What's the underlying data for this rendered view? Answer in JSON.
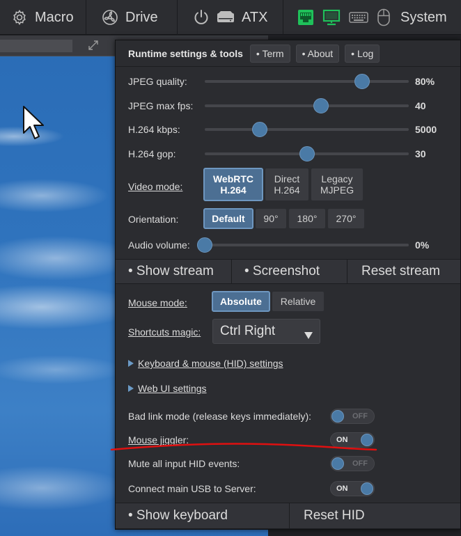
{
  "menubar": {
    "macro": "Macro",
    "drive": "Drive",
    "atx": "ATX",
    "system": "System"
  },
  "panel": {
    "title": "Runtime settings & tools",
    "buttons": [
      "• Term",
      "• About",
      "• Log"
    ]
  },
  "sliders": [
    {
      "label": "JPEG quality:",
      "value_text": "80%",
      "fraction": 0.77
    },
    {
      "label": "JPEG max fps:",
      "value_text": "40",
      "fraction": 0.57
    },
    {
      "label": "H.264 kbps:",
      "value_text": "5000",
      "fraction": 0.27
    },
    {
      "label": "H.264 gop:",
      "value_text": "30",
      "fraction": 0.5
    }
  ],
  "video_mode": {
    "label": "Video mode:",
    "options": [
      {
        "line1": "WebRTC",
        "line2": "H.264",
        "selected": true
      },
      {
        "line1": "Direct",
        "line2": "H.264",
        "selected": false
      },
      {
        "line1": "Legacy",
        "line2": "MJPEG",
        "selected": false
      }
    ]
  },
  "orientation": {
    "label": "Orientation:",
    "options": [
      {
        "text": "Default",
        "selected": true
      },
      {
        "text": "90°",
        "selected": false
      },
      {
        "text": "180°",
        "selected": false
      },
      {
        "text": "270°",
        "selected": false
      }
    ]
  },
  "audio": {
    "label": "Audio volume:",
    "value_text": "0%",
    "fraction": 0.0
  },
  "stream_buttons": [
    "• Show stream",
    "• Screenshot",
    "Reset stream"
  ],
  "mouse_mode": {
    "label": "Mouse mode:",
    "options": [
      {
        "text": "Absolute",
        "selected": true
      },
      {
        "text": "Relative",
        "selected": false
      }
    ]
  },
  "shortcuts": {
    "label": "Shortcuts magic:",
    "value": "Ctrl Right"
  },
  "expanders": [
    "Keyboard & mouse (HID) settings",
    "Web UI settings"
  ],
  "toggles": [
    {
      "label": "Bad link mode (release keys immediately):",
      "state": "OFF",
      "underline": false
    },
    {
      "label": "Mouse jiggler:",
      "state": "ON",
      "underline": true
    },
    {
      "label": "Mute all input HID events:",
      "state": "OFF",
      "underline": false
    },
    {
      "label": "Connect main USB to Server:",
      "state": "ON",
      "underline": false
    }
  ],
  "bottom_buttons": [
    "• Show keyboard",
    "Reset HID"
  ],
  "colors": {
    "accent": "#4a7aa6",
    "selected": "#4c6f93",
    "panel_bg": "#2b2c30",
    "status_green": "#1fc15a",
    "annotation_red": "#e01010"
  },
  "icons": [
    "gear-icon",
    "fan-icon",
    "power-icon",
    "hdd-icon",
    "ethernet-icon",
    "monitor-icon",
    "keyboard-icon",
    "mouse-icon",
    "expand-icon",
    "cursor-icon"
  ]
}
